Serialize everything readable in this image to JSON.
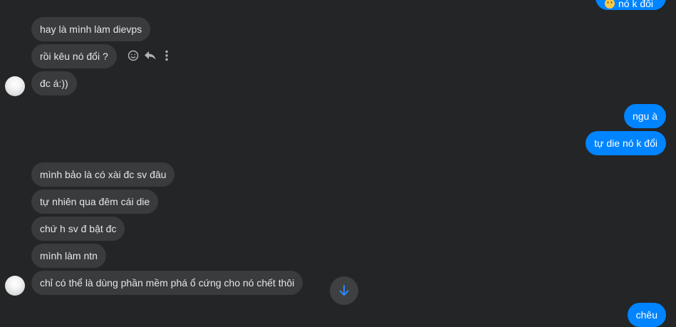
{
  "thread": {
    "incoming_group_1": [
      "hay là mình làm dievps",
      "rồi kêu nó đổi ?",
      "đc á:))"
    ],
    "outgoing_group_1": [
      "ngu à",
      "tự die nó k đổi"
    ],
    "incoming_group_2": [
      "mình bảo là có xài đc sv đâu",
      "tự nhiên qua đêm cái die",
      "chứ h sv đ bật đc",
      "mình làm ntn",
      "chỉ có thể là dùng phần mềm phá ổ cứng cho nó chết thôi"
    ],
    "outgoing_top_partial": "nó k đổi",
    "outgoing_last": "chêu"
  },
  "icons": {
    "react": "smiley-icon",
    "reply": "reply-arrow-icon",
    "more": "more-vertical-icon",
    "scroll": "arrow-down-icon",
    "emoji_in_partial": "emoji-face-icon"
  },
  "colors": {
    "background": "#242526",
    "incoming_bubble": "#3a3b3c",
    "outgoing_bubble": "#0084ff",
    "accent": "#2d88ff"
  }
}
